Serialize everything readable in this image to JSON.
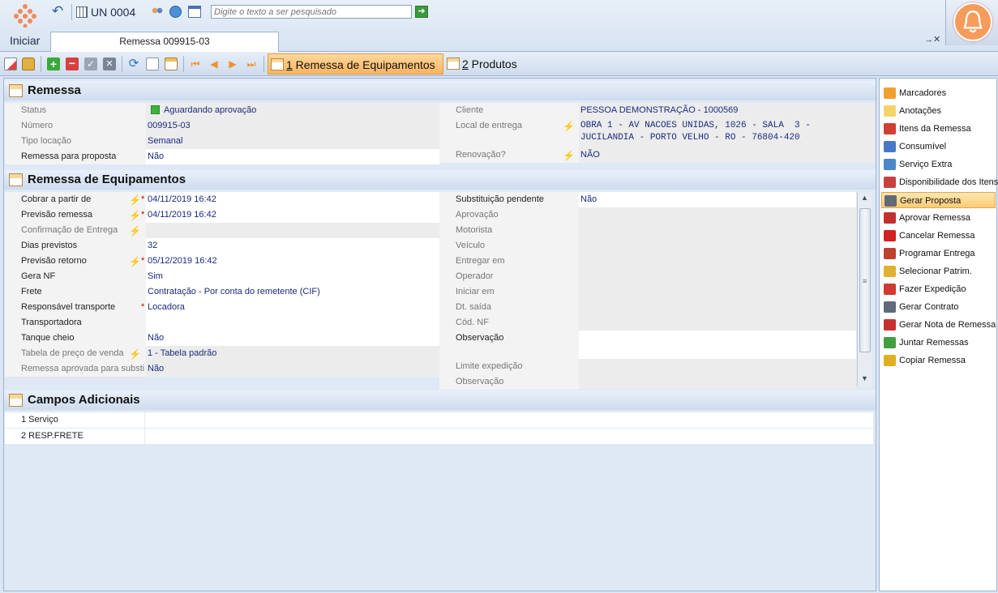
{
  "app": {
    "home_label": "Iniciar",
    "unit_label": "UN 0004",
    "search_placeholder": "Digite o texto a ser pesquisado",
    "doc_tab": "Remessa 009915-03",
    "close_label": "→✕"
  },
  "tabs": [
    {
      "num": "1",
      "label": " Remessa de Equipamentos"
    },
    {
      "num": "2",
      "label": " Produtos"
    }
  ],
  "sections": {
    "remessa": "Remessa",
    "equip": "Remessa de Equipamentos",
    "campos": "Campos Adicionais"
  },
  "remessa": {
    "status_label": "Status",
    "status_value": "Aguardando aprovação",
    "numero_label": "Número",
    "numero_value": "009915-03",
    "tipo_label": "Tipo locação",
    "tipo_value": "Semanal",
    "proposta_label": "Remessa para proposta",
    "proposta_value": "Não",
    "cliente_label": "Cliente",
    "cliente_value": "PESSOA DEMONSTRAÇÃO -  1000569",
    "local_label": "Local de entrega",
    "local_line1": "OBRA 1 - AV NACOES UNIDAS, 1026 - SALA  3 -",
    "local_line2": "JUCILANDIA - PORTO VELHO - RO - 76804-420",
    "renov_label": "Renovação?",
    "renov_value": "NÃO"
  },
  "equip": {
    "left": [
      {
        "label": "Cobrar a partir de",
        "value": "04/11/2019 16:42"
      },
      {
        "label": "Previsão remessa",
        "value": "04/11/2019 16:42"
      },
      {
        "label": "Confirmação de Entrega",
        "value": ""
      },
      {
        "label": "Dias previstos",
        "value": "32"
      },
      {
        "label": "Previsão retorno",
        "value": "05/12/2019 16:42"
      },
      {
        "label": "Gera NF",
        "value": "Sim"
      },
      {
        "label": "Frete",
        "value": "Contratação - Por conta do remetente (CIF)"
      },
      {
        "label": "Responsável transporte",
        "value": "Locadora"
      },
      {
        "label": "Transportadora",
        "value": ""
      },
      {
        "label": "Tanque cheio",
        "value": "Não"
      },
      {
        "label": "Tabela de preço de venda",
        "value": "1 - Tabela padrão"
      },
      {
        "label": "Remessa aprovada para substi",
        "value": "Não"
      }
    ],
    "right": [
      {
        "label": "Substituição pendente",
        "value": "Não"
      },
      {
        "label": "Aprovação",
        "value": ""
      },
      {
        "label": "Motorista",
        "value": ""
      },
      {
        "label": "Veículo",
        "value": ""
      },
      {
        "label": "Entregar em",
        "value": ""
      },
      {
        "label": "Operador",
        "value": ""
      },
      {
        "label": "Iniciar em",
        "value": ""
      },
      {
        "label": "Dt. saída",
        "value": ""
      },
      {
        "label": "Cód. NF",
        "value": ""
      },
      {
        "label": "Observação",
        "value": ""
      },
      {
        "label": "Limite expedição",
        "value": ""
      },
      {
        "label": "Observação",
        "value": ""
      }
    ]
  },
  "campos": [
    {
      "label": "1 Serviço",
      "value": ""
    },
    {
      "label": "2 RESP.FRETE",
      "value": ""
    }
  ],
  "sidebar": [
    {
      "label": "Marcadores",
      "icon": "tag-icon",
      "color": "#f0a030"
    },
    {
      "label": "Anotações",
      "icon": "notes-icon",
      "color": "#f3d36a"
    },
    {
      "label": "Itens da Remessa",
      "icon": "items-icon",
      "color": "#d04030"
    },
    {
      "label": "Consumível",
      "icon": "consumable-icon",
      "color": "#4a78c8"
    },
    {
      "label": "Serviço Extra",
      "icon": "wrench-icon",
      "color": "#4a88c8"
    },
    {
      "label": "Disponibilidade dos Itens",
      "icon": "calendar-icon",
      "color": "#c84040"
    },
    {
      "label": "Gerar Proposta",
      "icon": "printer-icon",
      "color": "#606a78"
    },
    {
      "label": "Aprovar Remessa",
      "icon": "approve-icon",
      "color": "#c03030"
    },
    {
      "label": "Cancelar Remessa",
      "icon": "cancel-icon",
      "color": "#d02020"
    },
    {
      "label": "Programar Entrega",
      "icon": "truck-icon",
      "color": "#c04030"
    },
    {
      "label": "Selecionar Patrim.",
      "icon": "select-icon",
      "color": "#e0b030"
    },
    {
      "label": "Fazer Expedição",
      "icon": "dispatch-icon",
      "color": "#d03a30"
    },
    {
      "label": "Gerar Contrato",
      "icon": "printer-icon",
      "color": "#606a78"
    },
    {
      "label": "Gerar Nota de Remessa",
      "icon": "invoice-icon",
      "color": "#c83030"
    },
    {
      "label": "Juntar Remessas",
      "icon": "merge-icon",
      "color": "#40a040"
    },
    {
      "label": "Copiar Remessa",
      "icon": "copy-icon",
      "color": "#e0b020"
    }
  ]
}
